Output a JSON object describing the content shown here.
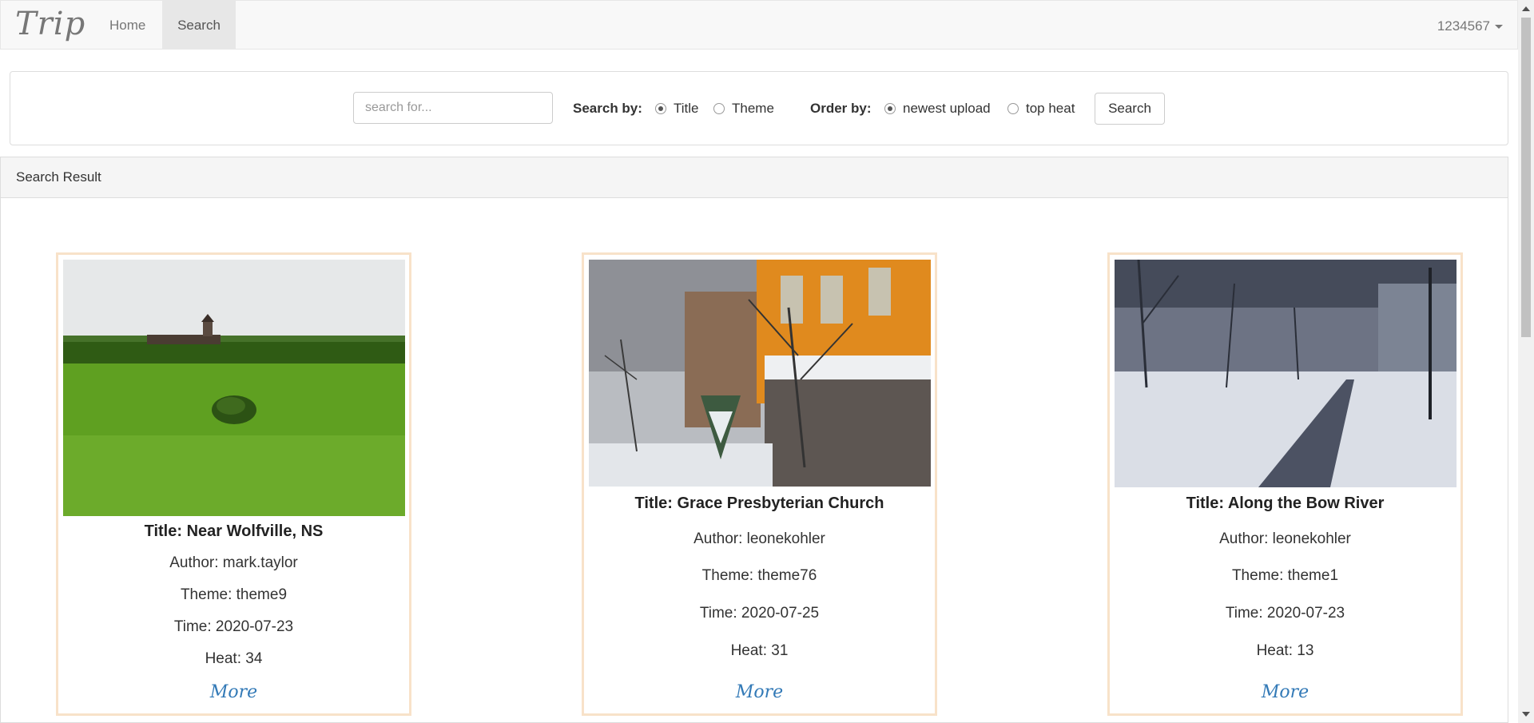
{
  "navbar": {
    "brand": "Trip",
    "links": [
      "Home",
      "Search"
    ],
    "active": "Search",
    "user": "1234567"
  },
  "search": {
    "placeholder": "search for...",
    "search_by_label": "Search by:",
    "search_by_options": [
      "Title",
      "Theme"
    ],
    "search_by_selected": "Title",
    "order_by_label": "Order by:",
    "order_by_options": [
      "newest upload",
      "top heat"
    ],
    "order_by_selected": "newest upload",
    "button_label": "Search"
  },
  "results": {
    "heading": "Search Result",
    "more_label": "More",
    "cards": [
      {
        "title": "Title: Near Wolfville, NS",
        "author": "Author: mark.taylor",
        "theme": "Theme: theme9",
        "time": "Time: 2020-07-23",
        "heat": "Heat: 34",
        "image": "green-field-photo"
      },
      {
        "title": "Title: Grace Presbyterian Church",
        "author": "Author: leonekohler",
        "theme": "Theme: theme76",
        "time": "Time: 2020-07-25",
        "heat": "Heat: 31",
        "image": "snowy-church-photo"
      },
      {
        "title": "Title: Along the Bow River",
        "author": "Author: leonekohler",
        "theme": "Theme: theme1",
        "time": "Time: 2020-07-23",
        "heat": "Heat: 13",
        "image": "snowy-path-photo"
      }
    ]
  },
  "colors": {
    "navbar_bg": "#f8f8f8",
    "link_blue": "#337ab7",
    "card_border": "#f8e2c9"
  }
}
